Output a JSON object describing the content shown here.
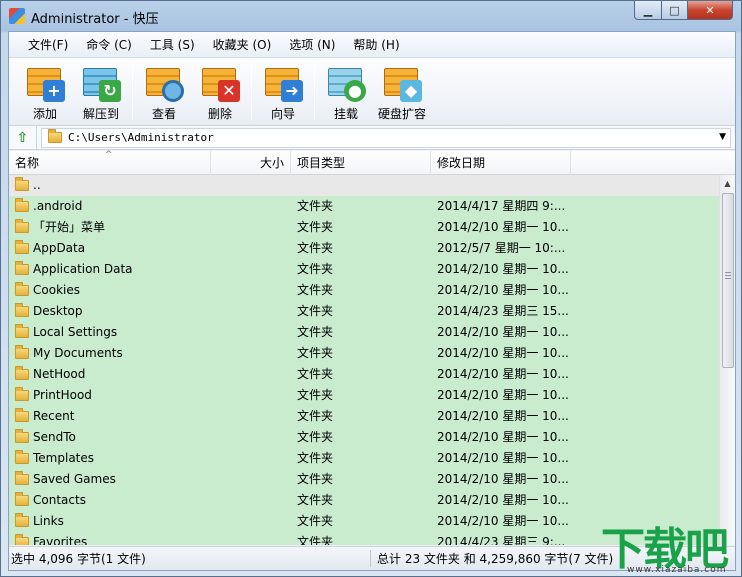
{
  "window": {
    "title": "Administrator - 快压"
  },
  "menu": [
    "文件(F)",
    "命令 (C)",
    "工具 (S)",
    "收藏夹 (O)",
    "选项 (N)",
    "帮助 (H)"
  ],
  "toolbar": {
    "add": "添加",
    "extract": "解压到",
    "view": "查看",
    "delete": "删除",
    "wizard": "向导",
    "mount": "挂载",
    "disk_expand": "硬盘扩容"
  },
  "address": {
    "path": "C:\\Users\\Administrator"
  },
  "columns": {
    "name": "名称",
    "size": "大小",
    "type": "项目类型",
    "date": "修改日期"
  },
  "rows": [
    {
      "name": "..",
      "type": "",
      "date": ""
    },
    {
      "name": ".android",
      "type": "文件夹",
      "date": "2014/4/17 星期四 9:..."
    },
    {
      "name": "「开始」菜单",
      "type": "文件夹",
      "date": "2014/2/10 星期一 10..."
    },
    {
      "name": "AppData",
      "type": "文件夹",
      "date": "2012/5/7 星期一 10:..."
    },
    {
      "name": "Application Data",
      "type": "文件夹",
      "date": "2014/2/10 星期一 10..."
    },
    {
      "name": "Cookies",
      "type": "文件夹",
      "date": "2014/2/10 星期一 10..."
    },
    {
      "name": "Desktop",
      "type": "文件夹",
      "date": "2014/4/23 星期三 15..."
    },
    {
      "name": "Local Settings",
      "type": "文件夹",
      "date": "2014/2/10 星期一 10..."
    },
    {
      "name": "My Documents",
      "type": "文件夹",
      "date": "2014/2/10 星期一 10..."
    },
    {
      "name": "NetHood",
      "type": "文件夹",
      "date": "2014/2/10 星期一 10..."
    },
    {
      "name": "PrintHood",
      "type": "文件夹",
      "date": "2014/2/10 星期一 10..."
    },
    {
      "name": "Recent",
      "type": "文件夹",
      "date": "2014/2/10 星期一 10..."
    },
    {
      "name": "SendTo",
      "type": "文件夹",
      "date": "2014/2/10 星期一 10..."
    },
    {
      "name": "Templates",
      "type": "文件夹",
      "date": "2014/2/10 星期一 10..."
    },
    {
      "name": "Saved Games",
      "type": "文件夹",
      "date": "2014/2/10 星期一 10..."
    },
    {
      "name": "Contacts",
      "type": "文件夹",
      "date": "2014/2/10 星期一 10..."
    },
    {
      "name": "Links",
      "type": "文件夹",
      "date": "2014/2/10 星期一 10..."
    },
    {
      "name": "Favorites",
      "type": "文件夹",
      "date": "2014/4/23 星期三 9:..."
    }
  ],
  "status": {
    "selected": "选中 4,096 字节(1 文件)",
    "total": "总计 23 文件夹 和 4,259,860 字节(7 文件)"
  },
  "watermark": {
    "main": "下载吧",
    "sub": "www.xiazaiba.com"
  },
  "colors": {
    "row_bg": "#c9ebce",
    "accent": "#1aa24a"
  }
}
